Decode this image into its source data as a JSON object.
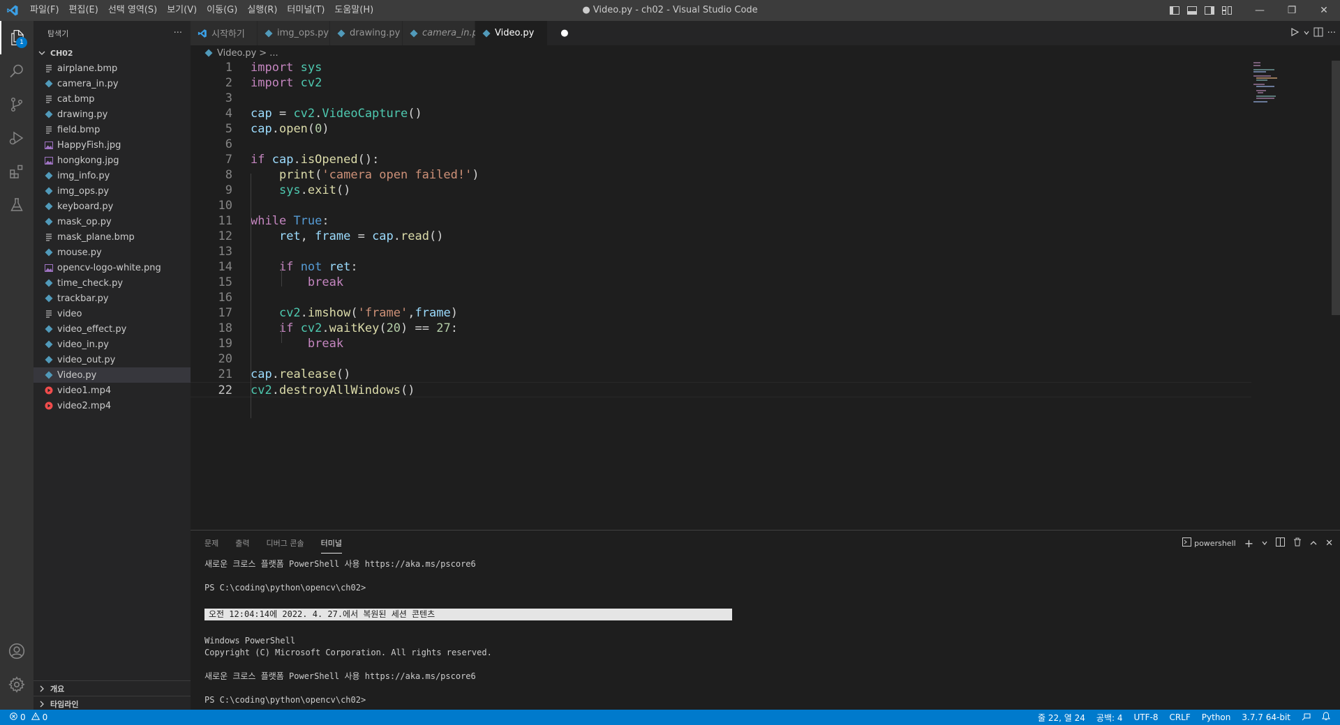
{
  "window": {
    "title": "● Video.py - ch02 - Visual Studio Code",
    "menu": [
      "파일(F)",
      "편집(E)",
      "선택 영역(S)",
      "보기(V)",
      "이동(G)",
      "실행(R)",
      "터미널(T)",
      "도움말(H)"
    ],
    "controls": {
      "minimize": "—",
      "maximize": "❐",
      "close": "✕"
    }
  },
  "activity": {
    "explorer_badge": "1"
  },
  "sidebar": {
    "title": "탐색기",
    "more": "···",
    "folder": "CH02",
    "files": [
      {
        "name": "airplane.bmp",
        "type": "bmp"
      },
      {
        "name": "camera_in.py",
        "type": "py"
      },
      {
        "name": "cat.bmp",
        "type": "bmp"
      },
      {
        "name": "drawing.py",
        "type": "py"
      },
      {
        "name": "field.bmp",
        "type": "bmp"
      },
      {
        "name": "HappyFish.jpg",
        "type": "img"
      },
      {
        "name": "hongkong.jpg",
        "type": "img"
      },
      {
        "name": "img_info.py",
        "type": "py"
      },
      {
        "name": "img_ops.py",
        "type": "py"
      },
      {
        "name": "keyboard.py",
        "type": "py"
      },
      {
        "name": "mask_op.py",
        "type": "py"
      },
      {
        "name": "mask_plane.bmp",
        "type": "bmp"
      },
      {
        "name": "mouse.py",
        "type": "py"
      },
      {
        "name": "opencv-logo-white.png",
        "type": "img"
      },
      {
        "name": "time_check.py",
        "type": "py"
      },
      {
        "name": "trackbar.py",
        "type": "py"
      },
      {
        "name": "video",
        "type": "bmp"
      },
      {
        "name": "video_effect.py",
        "type": "py"
      },
      {
        "name": "video_in.py",
        "type": "py"
      },
      {
        "name": "video_out.py",
        "type": "py"
      },
      {
        "name": "Video.py",
        "type": "py"
      },
      {
        "name": "video1.mp4",
        "type": "mp4"
      },
      {
        "name": "video2.mp4",
        "type": "mp4"
      }
    ],
    "selected_file": "Video.py",
    "outline_label": "개요",
    "timeline_label": "타임라인"
  },
  "tabs": [
    {
      "label": "시작하기",
      "type": "vscode",
      "active": false,
      "italic": false
    },
    {
      "label": "img_ops.py",
      "type": "py",
      "active": false,
      "italic": false
    },
    {
      "label": "drawing.py",
      "type": "py",
      "active": false,
      "italic": false
    },
    {
      "label": "camera_in.py",
      "type": "py",
      "active": false,
      "italic": true
    },
    {
      "label": "Video.py",
      "type": "py",
      "active": true,
      "italic": false,
      "dirty": "●"
    }
  ],
  "breadcrumb": {
    "file": "Video.py",
    "sep": ">",
    "more": "..."
  },
  "code": {
    "current_line": 22,
    "lines": [
      [
        [
          "kw",
          "import"
        ],
        [
          "txt",
          " "
        ],
        [
          "mod",
          "sys"
        ]
      ],
      [
        [
          "kw",
          "import"
        ],
        [
          "txt",
          " "
        ],
        [
          "mod",
          "cv2"
        ]
      ],
      [],
      [
        [
          "var",
          "cap"
        ],
        [
          "txt",
          " = "
        ],
        [
          "mod",
          "cv2"
        ],
        [
          "txt",
          "."
        ],
        [
          "mod",
          "VideoCapture"
        ],
        [
          "txt",
          "()"
        ]
      ],
      [
        [
          "var",
          "cap"
        ],
        [
          "txt",
          "."
        ],
        [
          "fn",
          "open"
        ],
        [
          "txt",
          "("
        ],
        [
          "num",
          "0"
        ],
        [
          "txt",
          ")"
        ]
      ],
      [],
      [
        [
          "kw",
          "if"
        ],
        [
          "txt",
          " "
        ],
        [
          "var",
          "cap"
        ],
        [
          "txt",
          "."
        ],
        [
          "fn",
          "isOpened"
        ],
        [
          "txt",
          "():"
        ]
      ],
      [
        [
          "txt",
          "    "
        ],
        [
          "fn",
          "print"
        ],
        [
          "txt",
          "("
        ],
        [
          "str",
          "'camera open failed!'"
        ],
        [
          "txt",
          ")"
        ]
      ],
      [
        [
          "txt",
          "    "
        ],
        [
          "mod",
          "sys"
        ],
        [
          "txt",
          "."
        ],
        [
          "fn",
          "exit"
        ],
        [
          "txt",
          "()"
        ]
      ],
      [],
      [
        [
          "kw",
          "while"
        ],
        [
          "txt",
          " "
        ],
        [
          "kwb",
          "True"
        ],
        [
          "txt",
          ":"
        ]
      ],
      [
        [
          "txt",
          "    "
        ],
        [
          "var",
          "ret"
        ],
        [
          "txt",
          ", "
        ],
        [
          "var",
          "frame"
        ],
        [
          "txt",
          " = "
        ],
        [
          "var",
          "cap"
        ],
        [
          "txt",
          "."
        ],
        [
          "fn",
          "read"
        ],
        [
          "txt",
          "()"
        ]
      ],
      [],
      [
        [
          "txt",
          "    "
        ],
        [
          "kw",
          "if"
        ],
        [
          "txt",
          " "
        ],
        [
          "kwb",
          "not"
        ],
        [
          "txt",
          " "
        ],
        [
          "var",
          "ret"
        ],
        [
          "txt",
          ":"
        ]
      ],
      [
        [
          "txt",
          "        "
        ],
        [
          "kw",
          "break"
        ]
      ],
      [],
      [
        [
          "txt",
          "    "
        ],
        [
          "mod",
          "cv2"
        ],
        [
          "txt",
          "."
        ],
        [
          "fn",
          "imshow"
        ],
        [
          "txt",
          "("
        ],
        [
          "str",
          "'frame'"
        ],
        [
          "txt",
          ","
        ],
        [
          "var",
          "frame"
        ],
        [
          "txt",
          ")"
        ]
      ],
      [
        [
          "txt",
          "    "
        ],
        [
          "kw",
          "if"
        ],
        [
          "txt",
          " "
        ],
        [
          "mod",
          "cv2"
        ],
        [
          "txt",
          "."
        ],
        [
          "fn",
          "waitKey"
        ],
        [
          "txt",
          "("
        ],
        [
          "num",
          "20"
        ],
        [
          "txt",
          ") == "
        ],
        [
          "num",
          "27"
        ],
        [
          "txt",
          ":"
        ]
      ],
      [
        [
          "txt",
          "        "
        ],
        [
          "kw",
          "break"
        ]
      ],
      [],
      [
        [
          "var",
          "cap"
        ],
        [
          "txt",
          "."
        ],
        [
          "fn",
          "realease"
        ],
        [
          "txt",
          "()"
        ]
      ],
      [
        [
          "mod",
          "cv2"
        ],
        [
          "txt",
          "."
        ],
        [
          "fn",
          "destroyAllWindows"
        ],
        [
          "txt",
          "()"
        ]
      ]
    ]
  },
  "panel": {
    "tabs": [
      {
        "label": "문제",
        "active": false
      },
      {
        "label": "출력",
        "active": false
      },
      {
        "label": "디버그 콘솔",
        "active": false
      },
      {
        "label": "터미널",
        "active": true
      }
    ],
    "shell": "powershell",
    "terminal_lines": [
      {
        "text": "새로운 크로스 플랫폼 PowerShell 사용 https://aka.ms/pscore6",
        "hl": false
      },
      {
        "text": "",
        "hl": false
      },
      {
        "text": "PS C:\\coding\\python\\opencv\\ch02>",
        "hl": false
      },
      {
        "text": "",
        "hl": false
      },
      {
        "text": "오전 12:04:14에 2022. 4. 27.에서 복원된 세션 콘텐츠",
        "hl": true
      },
      {
        "text": "",
        "hl": false
      },
      {
        "text": "Windows PowerShell",
        "hl": false
      },
      {
        "text": "Copyright (C) Microsoft Corporation. All rights reserved.",
        "hl": false
      },
      {
        "text": "",
        "hl": false
      },
      {
        "text": "새로운 크로스 플랫폼 PowerShell 사용 https://aka.ms/pscore6",
        "hl": false
      },
      {
        "text": "",
        "hl": false
      },
      {
        "text": "PS C:\\coding\\python\\opencv\\ch02>",
        "hl": false
      }
    ]
  },
  "status": {
    "errors": "0",
    "warnings": "0",
    "position": "줄 22, 열 24",
    "spaces": "공백: 4",
    "encoding": "UTF-8",
    "eol": "CRLF",
    "language": "Python",
    "interpreter": "3.7.7 64-bit"
  },
  "colors": {
    "accent": "#007acc",
    "editor_bg": "#1e1e1e",
    "sidebar_bg": "#252526",
    "activity_bg": "#333333",
    "python_icon": "#519aba",
    "image_icon": "#a074c4",
    "mp4_icon": "#f14c4c"
  },
  "icons": [
    "vscode-logo-icon",
    "files-icon",
    "search-icon",
    "source-control-icon",
    "run-debug-icon",
    "extensions-icon",
    "testing-icon",
    "account-icon",
    "settings-gear-icon"
  ]
}
